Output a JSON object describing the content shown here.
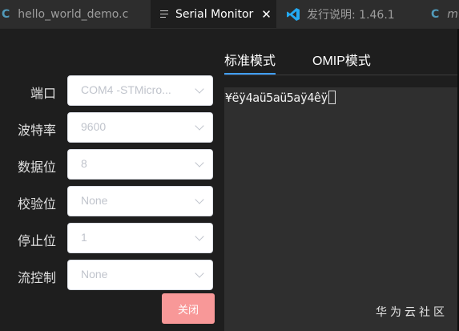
{
  "tabs": [
    {
      "label": "hello_world_demo.c",
      "icon": "c-file-icon"
    },
    {
      "label": "Serial Monitor",
      "icon": "lines-icon"
    },
    {
      "label": "发行说明: 1.46.1",
      "icon": "vscode-icon"
    },
    {
      "label": "m",
      "icon": "c-file-icon"
    }
  ],
  "serial": {
    "port": {
      "label": "端口",
      "value": "COM4 -STMicro..."
    },
    "baud": {
      "label": "波特率",
      "value": "9600"
    },
    "databits": {
      "label": "数据位",
      "value": "8"
    },
    "parity": {
      "label": "校验位",
      "value": "None"
    },
    "stopbits": {
      "label": "停止位",
      "value": "1"
    },
    "flow": {
      "label": "流控制",
      "value": "None"
    },
    "close_label": "关闭"
  },
  "modes": {
    "standard": "标准模式",
    "omip": "OMIP模式"
  },
  "output": {
    "text": "¥ëÿ4aü5aü5aÿ4êÿ"
  },
  "watermark": "华为云社区",
  "colors": {
    "accent": "#409eff",
    "close_button": "#f89898",
    "c_icon": "#519aba",
    "vscode_icon": "#23a9f2"
  }
}
